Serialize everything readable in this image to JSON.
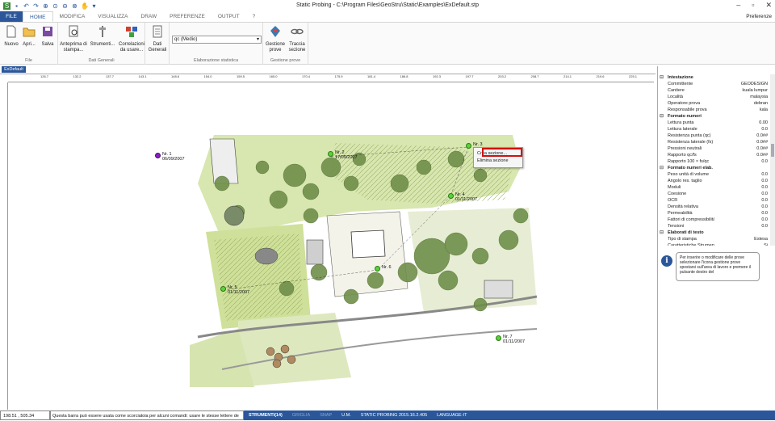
{
  "window": {
    "title": "Static Probing - C:\\Program Files\\GeoStru\\Static\\Examples\\ExDefault.stp"
  },
  "tabs": [
    "FILE",
    "HOME",
    "MODIFICA",
    "VISUALIZZA",
    "DRAW",
    "PREFERENZE",
    "OUTPUT",
    "?"
  ],
  "preferences_label": "Preferenze",
  "ribbon": {
    "nuovo": "Nuovo",
    "apri": "Apri...",
    "salva": "Salva",
    "file_group": "File",
    "anteprima": "Anteprima di stampa...",
    "strumenti": "Strumenti...",
    "correlazioni": "Correlazioni da usare...",
    "dati_generali_btn": "Dati Generali",
    "dati_group": "Dati Generali",
    "combo_value": "qc (Medio)",
    "elab_group": "Elaborazione statistica",
    "gestione": "Gestione prove",
    "traccia": "Traccia sezione",
    "gestione_group": "Gestione prove"
  },
  "doc_tab": "ExDefault",
  "ruler_ticks": [
    "126.7",
    "132.2",
    "137.7",
    "143.1",
    "148.6",
    "154.0",
    "159.5",
    "165.0",
    "170.4",
    "175.9",
    "181.4",
    "186.8",
    "192.3",
    "197.7",
    "203.2",
    "208.7",
    "214.1",
    "219.6",
    "225.1"
  ],
  "probes": [
    {
      "label": "Nr. 1",
      "date": "06/09/2007",
      "color": "#8a1fc0"
    },
    {
      "label": "Nr. 2",
      "date": "17/09/2007",
      "color": "#5bd13a"
    },
    {
      "label": "Nr. 3",
      "date": "",
      "color": "#5bd13a"
    },
    {
      "label": "Nr. 4",
      "date": "01/11/2007",
      "color": "#5bd13a"
    },
    {
      "label": "Nr. 5",
      "date": "01/11/2007",
      "color": "#5bd13a"
    },
    {
      "label": "Nr. 6",
      "date": "",
      "color": "#5bd13a"
    },
    {
      "label": "Nr. 7",
      "date": "01/11/2007",
      "color": "#5bd13a"
    }
  ],
  "context_menu": [
    "Crea sezione...",
    "Elimina sezione"
  ],
  "properties": {
    "intestazione": {
      "title": "Intestazione",
      "rows": [
        [
          "Committente",
          "GEODESIGN"
        ],
        [
          "Cantiere",
          "kuala lumpur"
        ],
        [
          "Località",
          "malaysia"
        ],
        [
          "Operatore prova",
          "debran"
        ],
        [
          "Responsabile prova",
          "kala"
        ]
      ]
    },
    "formato": {
      "title": "Formato numeri",
      "rows": [
        [
          "Lettura punta",
          "0.00"
        ],
        [
          "Lettura laterale",
          "0.0"
        ],
        [
          "Resistenza punta (qc)",
          "0.0##"
        ],
        [
          "Resistenza laterale (fs)",
          "0.0##"
        ],
        [
          "Pressioni neutrali",
          "0.0##"
        ],
        [
          "Rapporto qc/fs",
          "0.0##"
        ],
        [
          "Rapporto 100 × fs/qc",
          "0.0"
        ]
      ]
    },
    "formato_elab": {
      "title": "Formato numeri elab.",
      "rows": [
        [
          "Peso unità di volume",
          "0.0"
        ],
        [
          "Angolo res. taglio",
          "0.0"
        ],
        [
          "Moduli",
          "0.0"
        ],
        [
          "Coesione",
          "0.0"
        ],
        [
          "OCR",
          "0.0"
        ],
        [
          "Densità relativa",
          "0.0"
        ],
        [
          "Permeabilità",
          "0.0"
        ],
        [
          "Fattori di compressibilità",
          "0.0"
        ],
        [
          "Tensioni",
          "0.0"
        ]
      ]
    },
    "elaborati": {
      "title": "Elaborati di testo",
      "rows": [
        [
          "Tipo di stampa",
          "Estesa"
        ],
        [
          "Caratteristiche Strumentali",
          "Si"
        ]
      ]
    }
  },
  "info_text": "Per inserire o modificare delle prove selezionare l'icona gestione prove spostarsi sull'area di lavoro e premere il pulsante destro del",
  "status": {
    "coords": "198.51 , 505.34",
    "command": "Questa barra può essere usata come scorciatoia per alcuni comandi: usare le stesse lettere de",
    "strumenti": "STRUMENTI(14)",
    "griglia": "GRIGLIA",
    "snap": "SNAP",
    "um": "U.M.",
    "version": "STATIC PROBING 2015.16.2.405",
    "language": "LANGUAGE-IT"
  },
  "colors": {
    "accent": "#2b579a",
    "highlight": "#d01010",
    "grass": "#b9d27a",
    "tree": "#6f8f4a"
  }
}
